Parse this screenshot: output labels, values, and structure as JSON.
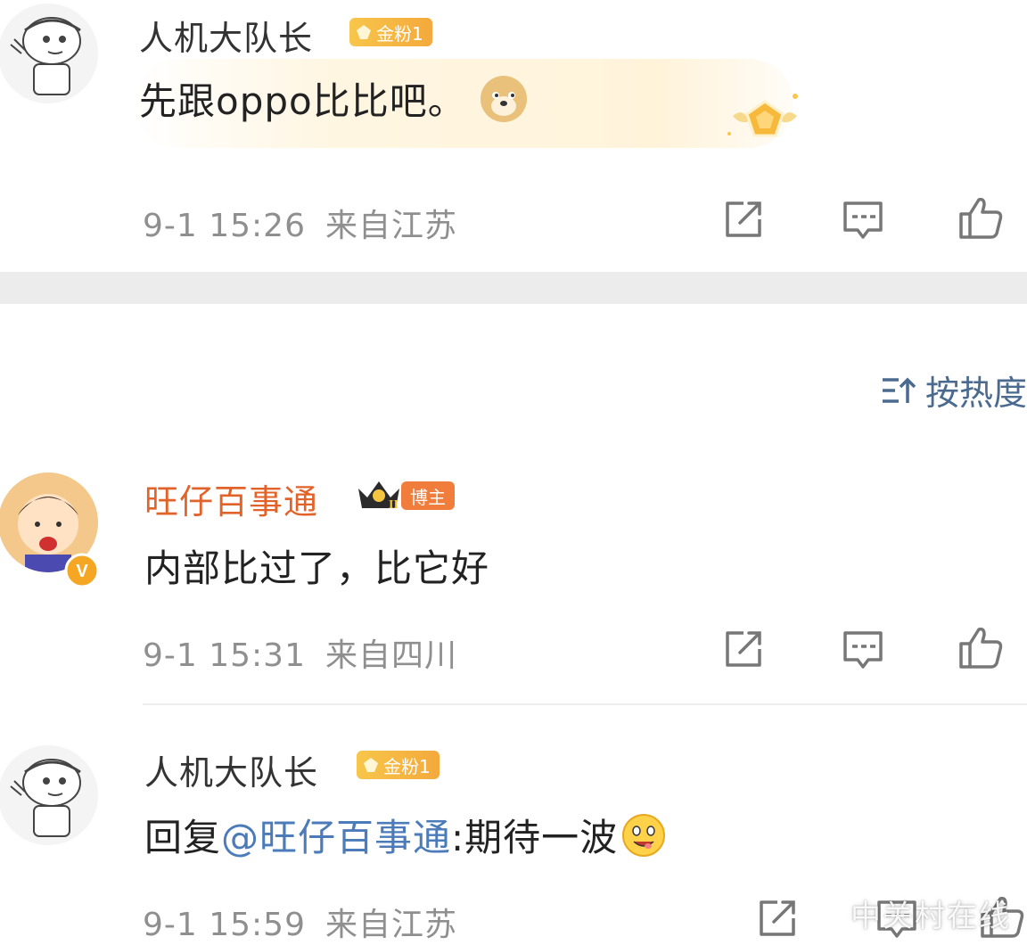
{
  "comments": [
    {
      "username": "人机大队长",
      "badge": "金粉1",
      "text": "先跟oppo比比吧。",
      "time": "9-1 15:26",
      "location": "来自江苏",
      "emoji": "doge-emoji"
    },
    {
      "username": "旺仔百事通",
      "crown_level": "II",
      "badge": "博主",
      "verified_mark": "V",
      "text": "内部比过了，比它好",
      "time": "9-1 15:31",
      "location": "来自四川"
    },
    {
      "username": "人机大队长",
      "badge": "金粉1",
      "reply_prefix": "回复",
      "mention": "@旺仔百事通",
      "text_after_mention": ":期待一波",
      "time": "9-1 15:59",
      "location": "来自江苏",
      "emoji": "drool-emoji"
    }
  ],
  "sort": {
    "label": "按热度"
  },
  "watermark": {
    "label": "中关村在线"
  },
  "colors": {
    "orange_username": "#e2632a",
    "mention_blue": "#4b7bb8",
    "meta_gray": "#8f8f8f",
    "badge_gold": "#f7c64a",
    "blogger_badge": "#f07d3c"
  }
}
